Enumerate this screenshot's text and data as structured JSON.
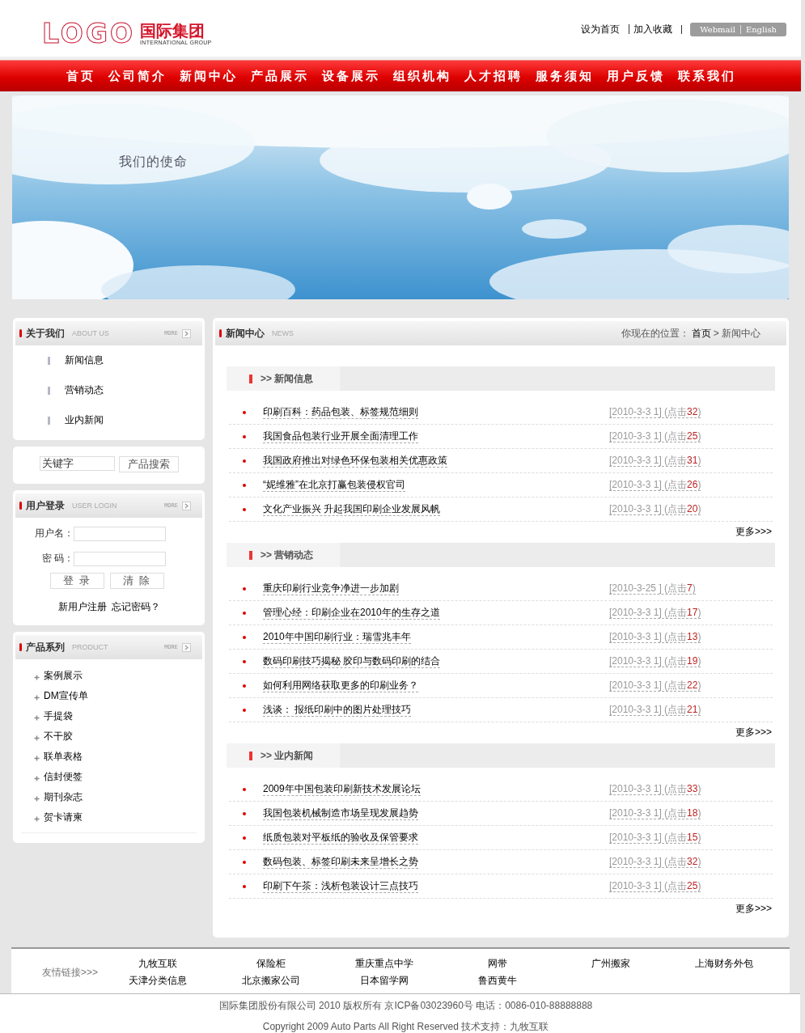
{
  "header": {
    "logo_text": "LOGO",
    "brand": "国际集团",
    "brand_sub": "INTERNATIONAL GROUP",
    "top_links": [
      "设为首页",
      "加入收藏"
    ],
    "lang_links": [
      "Webmail",
      "English"
    ]
  },
  "nav": [
    "首页",
    "公司简介",
    "新闻中心",
    "产品展示",
    "设备展示",
    "组织机构",
    "人才招聘",
    "服务须知",
    "用户反馈",
    "联系我们"
  ],
  "banner": {
    "caption": "我们的使命"
  },
  "sidebar": {
    "about": {
      "title": "关于我们",
      "subtitle": "ABOUT US",
      "more": "MORE",
      "items": [
        "新闻信息",
        "营销动态",
        "业内新闻"
      ]
    },
    "search": {
      "value": "关键字",
      "button": "产品搜索"
    },
    "login": {
      "title": "用户登录",
      "subtitle": "USER LOGIN",
      "more": "MORE",
      "fields": [
        "用户名：",
        "密 码："
      ],
      "buttons": [
        "登 录",
        "清 除"
      ],
      "links": [
        "新用户注册",
        "忘记密码？"
      ]
    },
    "products": {
      "title": "产品系列",
      "subtitle": "PRODUCT",
      "more": "MORE",
      "items": [
        "案例展示",
        "DM宣传单",
        "手提袋",
        "不干胶",
        "联单表格",
        "信封便签",
        "期刊杂志",
        "贺卡请柬"
      ]
    }
  },
  "main": {
    "title": "新闻中心",
    "subtitle": "NEWS",
    "breadcrumb": {
      "prefix": "你现在的位置：",
      "home": "首页",
      "current": "> 新闻中心"
    },
    "sections": [
      {
        "title": ">> 新闻信息",
        "more": "更多>>>",
        "items": [
          {
            "title": "印刷百科：药品包装、标签规范细则",
            "meta": "[2010-3-3 1] (点击",
            "hits": "32",
            "meta_end": ")"
          },
          {
            "title": "我国食品包装行业开展全面清理工作",
            "meta": "[2010-3-3 1] (点击",
            "hits": "25",
            "meta_end": ")"
          },
          {
            "title": "我国政府推出对绿色环保包装相关优惠政策",
            "meta": "[2010-3-3 1] (点击",
            "hits": "31",
            "meta_end": ")"
          },
          {
            "title": "“妮维雅”在北京打赢包装侵权官司",
            "meta": "[2010-3-3 1] (点击",
            "hits": "26",
            "meta_end": ")"
          },
          {
            "title": "文化产业振兴 升起我国印刷企业发展风帆",
            "meta": "[2010-3-3 1] (点击",
            "hits": "20",
            "meta_end": ")"
          }
        ]
      },
      {
        "title": ">> 营销动态",
        "more": "更多>>>",
        "items": [
          {
            "title": "重庆印刷行业竞争净进一步加剧",
            "meta": "[2010-3-25 ] (点击",
            "hits": "7",
            "meta_end": ")"
          },
          {
            "title": "管理心经：印刷企业在2010年的生存之道",
            "meta": "[2010-3-3 1] (点击",
            "hits": "17",
            "meta_end": ")"
          },
          {
            "title": "2010年中国印刷行业：瑞雪兆丰年",
            "meta": "[2010-3-3 1] (点击",
            "hits": "13",
            "meta_end": ")"
          },
          {
            "title": "数码印刷技巧揭秘 胶印与数码印刷的结合",
            "meta": "[2010-3-3 1] (点击",
            "hits": "19",
            "meta_end": ")"
          },
          {
            "title": "如何利用网络获取更多的印刷业务？",
            "meta": "[2010-3-3 1] (点击",
            "hits": "22",
            "meta_end": ")"
          },
          {
            "title": "浅谈： 报纸印刷中的图片处理技巧",
            "meta": "[2010-3-3 1] (点击",
            "hits": "21",
            "meta_end": ")"
          }
        ]
      },
      {
        "title": ">> 业内新闻",
        "more": "更多>>>",
        "items": [
          {
            "title": "2009年中国包装印刷新技术发展论坛",
            "meta": "[2010-3-3 1] (点击",
            "hits": "33",
            "meta_end": ")"
          },
          {
            "title": "我国包装机械制造市场呈现发展趋势",
            "meta": "[2010-3-3 1] (点击",
            "hits": "18",
            "meta_end": ")"
          },
          {
            "title": "纸质包装对平板纸的验收及保管要求",
            "meta": "[2010-3-3 1] (点击",
            "hits": "15",
            "meta_end": ")"
          },
          {
            "title": "数码包装、标签印刷未来呈增长之势",
            "meta": "[2010-3-3 1] (点击",
            "hits": "32",
            "meta_end": ")"
          },
          {
            "title": "印刷下午茶：浅析包装设计三点技巧",
            "meta": "[2010-3-3 1] (点击",
            "hits": "25",
            "meta_end": ")"
          }
        ]
      }
    ]
  },
  "footer": {
    "links_label": "友情链接>>>",
    "links": [
      "九牧互联",
      "保险柜",
      "重庆重点中学",
      "网带",
      "广州搬家",
      "上海财务外包",
      "天津分类信息",
      "北京搬家公司",
      "日本留学网",
      "鲁西黄牛"
    ],
    "copyright": [
      "国际集团股份有限公司 2010 版权所有 京ICP备03023960号 电话：0086-010-88888888",
      "Copyright 2009 Auto Parts All Right Reserved 技术支持：九牧互联"
    ]
  }
}
